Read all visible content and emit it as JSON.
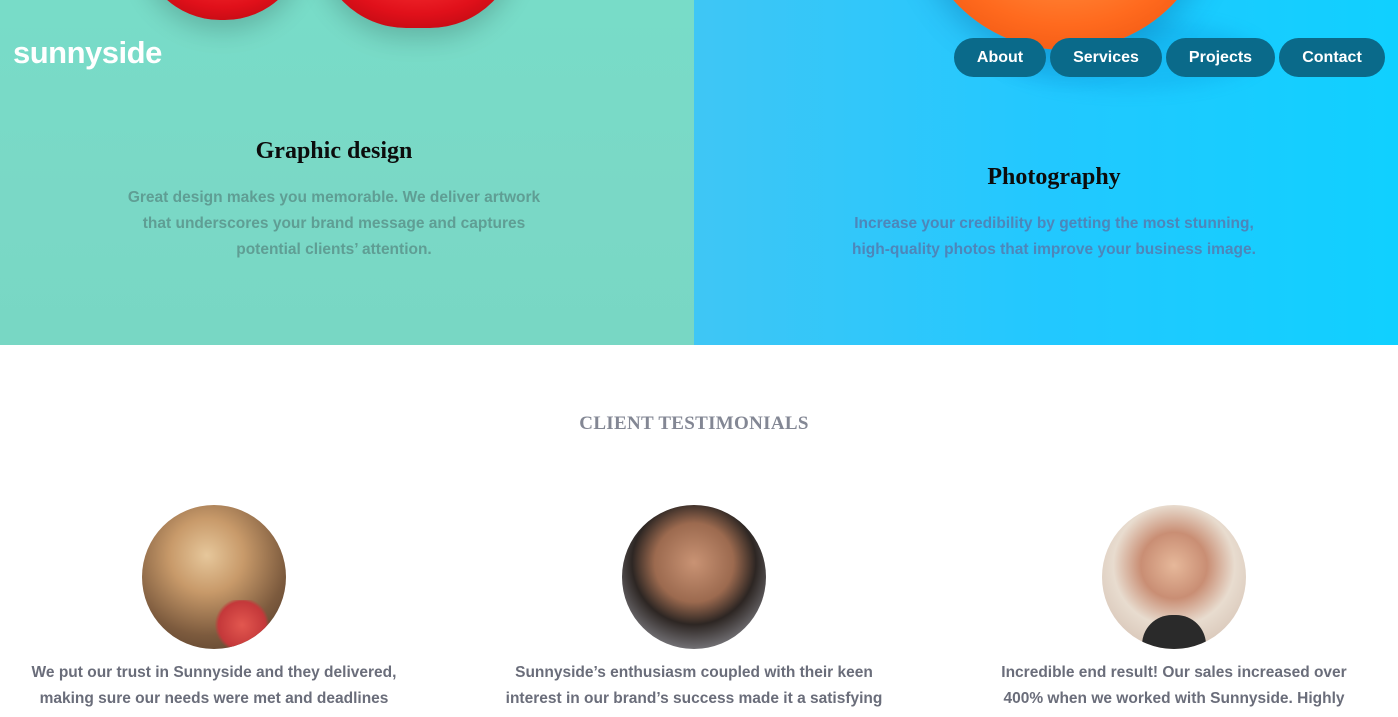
{
  "brand": {
    "logo": "sunnyside"
  },
  "nav": {
    "items": [
      {
        "label": "About"
      },
      {
        "label": "Services"
      },
      {
        "label": "Projects"
      },
      {
        "label": "Contact"
      }
    ]
  },
  "services": [
    {
      "title": "Graphic design",
      "description": "Great design makes you memorable. We deliver artwork that underscores your brand message and captures potential clients’ attention."
    },
    {
      "title": "Photography",
      "description": "Increase your credibility by getting the most stunning, high-quality photos that improve your business image."
    }
  ],
  "testimonials": {
    "title": "CLIENT TESTIMONIALS",
    "items": [
      {
        "quote": "We put our trust in Sunnyside and they delivered, making sure our needs were met and deadlines were always hit."
      },
      {
        "quote": "Sunnyside’s enthusiasm coupled with their keen interest in our brand’s success made it a satisfying and enjoyable experience."
      },
      {
        "quote": "Incredible end result! Our sales increased over 400% when we worked with Sunnyside. Highly recommended!"
      }
    ]
  }
}
